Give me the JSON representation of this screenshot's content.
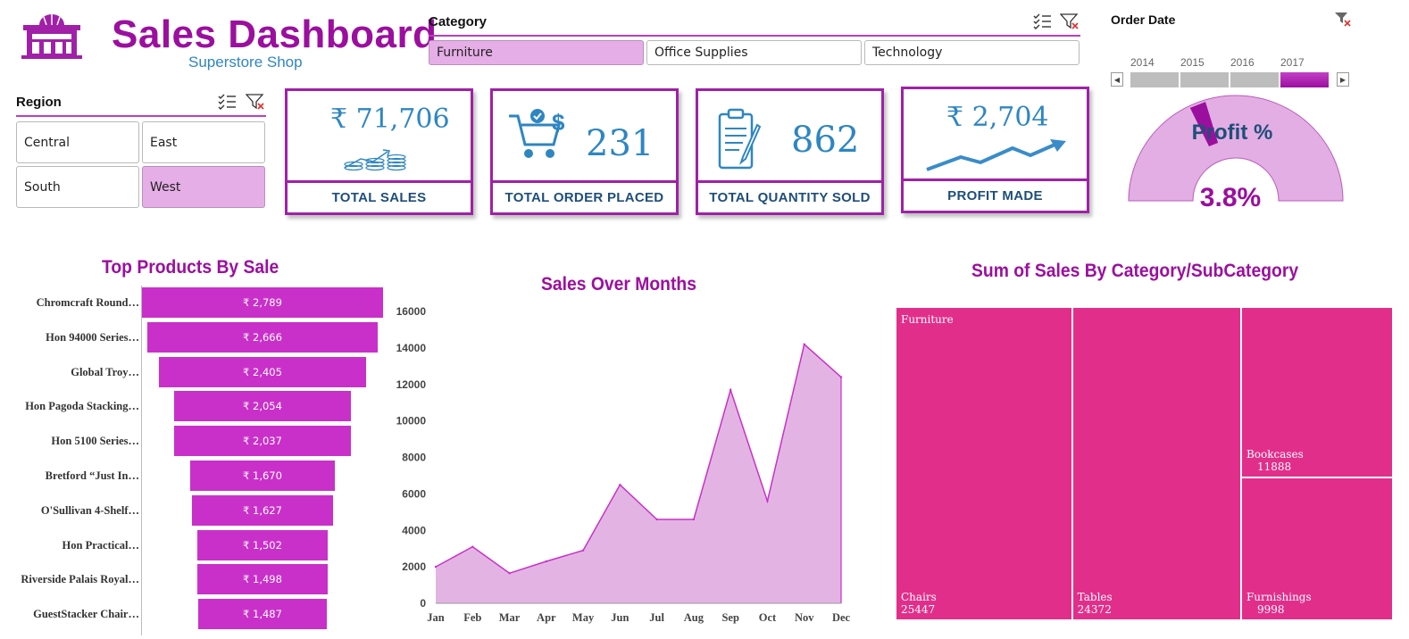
{
  "header": {
    "title": "Sales Dashboard",
    "subtitle": "Superstore Shop",
    "logo_icon": "store-building-icon"
  },
  "region_slicer": {
    "title": "Region",
    "items": [
      {
        "label": "Central",
        "selected": false
      },
      {
        "label": "East",
        "selected": false
      },
      {
        "label": "South",
        "selected": false
      },
      {
        "label": "West",
        "selected": true
      }
    ]
  },
  "category_slicer": {
    "title": "Category",
    "items": [
      {
        "label": "Furniture",
        "selected": true
      },
      {
        "label": "Office Supplies",
        "selected": false
      },
      {
        "label": "Technology",
        "selected": false
      }
    ]
  },
  "date_slicer": {
    "title": "Order Date",
    "years": [
      "2014",
      "2015",
      "2016",
      "2017"
    ],
    "selected_year": "2017"
  },
  "kpis": {
    "total_sales": {
      "value": "₹ 71,706",
      "label": "TOTAL SALES",
      "icon": "money-stack-icon"
    },
    "total_orders": {
      "value": "231",
      "label": "TOTAL ORDER PLACED",
      "icon": "shopping-cart-icon"
    },
    "total_quantity": {
      "value": "862",
      "label": "TOTAL QUANTITY SOLD",
      "icon": "clipboard-icon"
    },
    "profit": {
      "value": "₹ 2,704",
      "label": "PROFIT MADE",
      "icon": "trend-arrow-icon"
    }
  },
  "gauge": {
    "title": "Profit %",
    "value_text": "3.8%",
    "value": 3.8
  },
  "colors": {
    "accent": "#9b0f9f",
    "bar": "#c930c9",
    "area_fill": "#e3b4e3",
    "treemap": "#e22e8b",
    "kpi_text": "#2e86c1"
  },
  "chart_data": [
    {
      "type": "bar",
      "orientation": "funnel",
      "title": "Top Products By Sale",
      "categories": [
        "Chromcraft Round…",
        "Hon 94000 Series…",
        "Global Troy…",
        "Hon Pagoda Stacking…",
        "Hon 5100 Series…",
        "Bretford “Just In…",
        "O'Sullivan 4-Shelf…",
        "Hon Practical…",
        "Riverside Palais Royal…",
        "GuestStacker Chair…"
      ],
      "values": [
        2789,
        2666,
        2405,
        2054,
        2037,
        1670,
        1627,
        1502,
        1498,
        1487
      ],
      "value_labels": [
        "₹ 2,789",
        "₹ 2,666",
        "₹ 2,405",
        "₹ 2,054",
        "₹ 2,037",
        "₹ 1,670",
        "₹ 1,627",
        "₹ 1,502",
        "₹ 1,498",
        "₹ 1,487"
      ]
    },
    {
      "type": "area",
      "title": "Sales Over Months",
      "categories": [
        "Jan",
        "Feb",
        "Mar",
        "Apr",
        "May",
        "Jun",
        "Jul",
        "Aug",
        "Sep",
        "Oct",
        "Nov",
        "Dec"
      ],
      "values": [
        2000,
        3100,
        1650,
        2300,
        2900,
        6500,
        4600,
        4600,
        11700,
        5600,
        14200,
        12400
      ],
      "ylim": [
        0,
        16000
      ],
      "yticks": [
        "0",
        "2000",
        "4000",
        "6000",
        "8000",
        "10000",
        "12000",
        "14000",
        "16000"
      ],
      "grid": false
    },
    {
      "type": "treemap",
      "title": "Sum of Sales By Category/SubCategory",
      "parent": "Furniture",
      "items": [
        {
          "name": "Chairs",
          "value": 25447
        },
        {
          "name": "Tables",
          "value": 24372
        },
        {
          "name": "Bookcases",
          "value": 11888
        },
        {
          "name": "Furnishings",
          "value": 9998
        }
      ]
    }
  ]
}
